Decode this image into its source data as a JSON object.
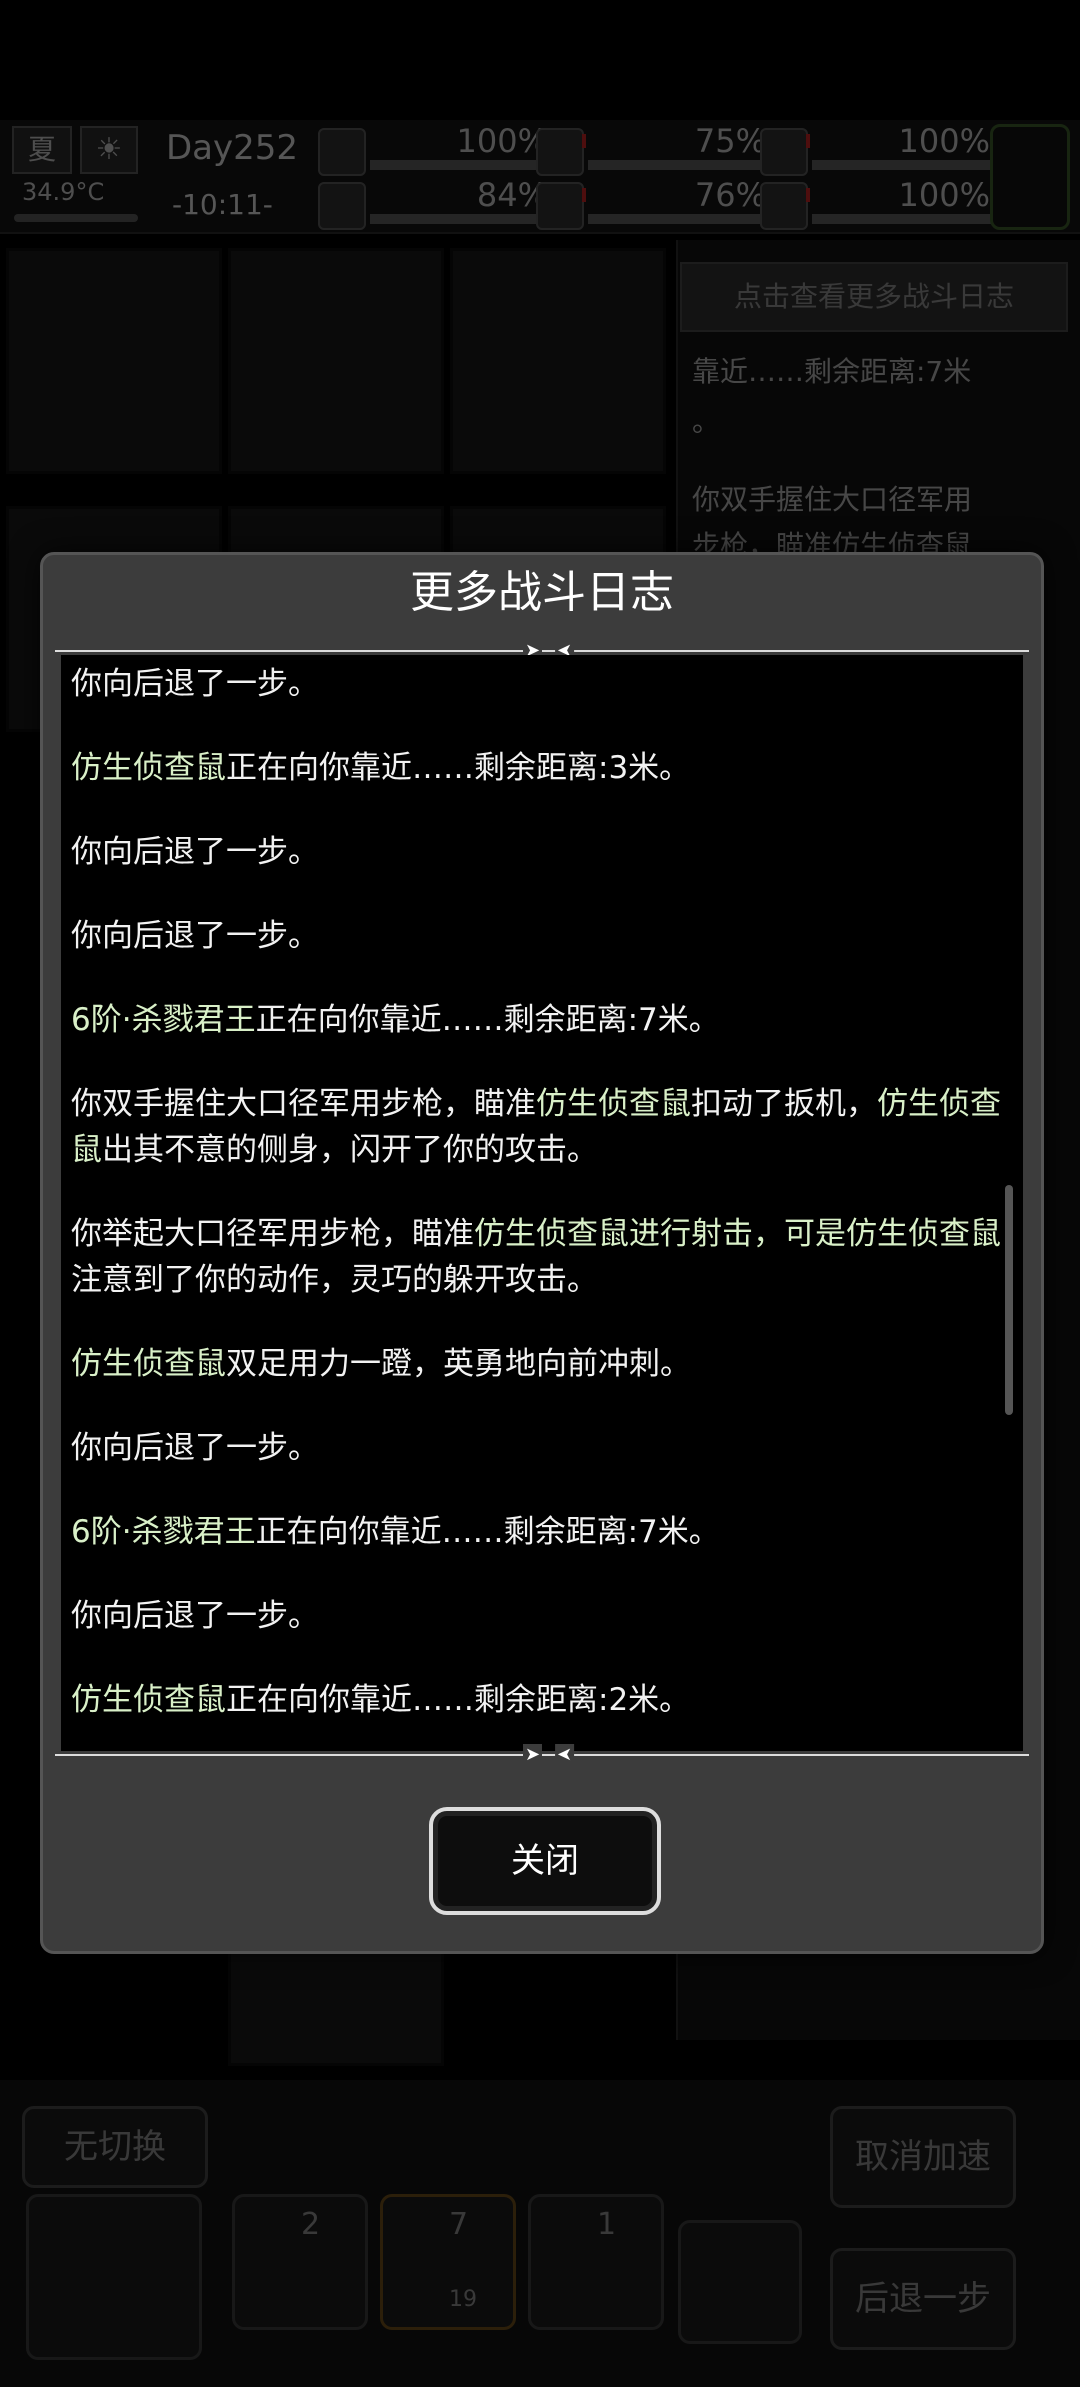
{
  "status": {
    "season": "夏",
    "temperature": "34.9°C",
    "day": "Day252",
    "time": "-10:11-",
    "stats": [
      {
        "icon": "medkit-icon",
        "pct": "100%"
      },
      {
        "icon": "stomach-icon",
        "pct": "75%"
      },
      {
        "icon": "pill-icon",
        "pct": "100%"
      },
      {
        "icon": "leg-icon",
        "pct": "84%"
      },
      {
        "icon": "water-drop-icon",
        "pct": "76%"
      },
      {
        "icon": "heart-icon",
        "pct": "100%"
      }
    ]
  },
  "side_panel": {
    "button": "点击查看更多战斗日志",
    "lines": [
      "靠近……剩余距离:7米",
      "。",
      "你双手握住大口径军用",
      "步枪，瞄准仿生侦查鼠"
    ]
  },
  "dialog": {
    "title": "更多战斗日志",
    "close_label": "关闭",
    "entries": [
      [
        {
          "t": "你向后退了一步。"
        }
      ],
      [
        {
          "t": "仿生侦查鼠",
          "mob": true
        },
        {
          "t": "正在向你靠近……剩余距离:3米。"
        }
      ],
      [
        {
          "t": "你向后退了一步。"
        }
      ],
      [
        {
          "t": "你向后退了一步。"
        }
      ],
      [
        {
          "t": "6阶·杀戮君王",
          "mob": true
        },
        {
          "t": "正在向你靠近……剩余距离:7米。"
        }
      ],
      [
        {
          "t": "你双手握住大口径军用步枪，瞄准"
        },
        {
          "t": "仿生侦查鼠",
          "mob": true
        },
        {
          "t": "扣动了扳机，"
        },
        {
          "t": "仿生侦查鼠",
          "mob": true
        },
        {
          "t": "出其不意的侧身，闪开了你的攻击。"
        }
      ],
      [
        {
          "t": "你举起大口径军用步枪，瞄准"
        },
        {
          "t": "仿生侦查鼠",
          "mob": true
        },
        {
          "t": "进行射击，可是仿生侦查鼠",
          "mob": true
        },
        {
          "t": "注意到了你的动作，灵巧的躲开攻击。"
        }
      ],
      [
        {
          "t": "仿生侦查鼠",
          "mob": true
        },
        {
          "t": "双足用力一蹬，英勇地向前冲刺。"
        }
      ],
      [
        {
          "t": "你向后退了一步。"
        }
      ],
      [
        {
          "t": "6阶·杀戮君王",
          "mob": true
        },
        {
          "t": "正在向你靠近……剩余距离:7米。"
        }
      ],
      [
        {
          "t": "你向后退了一步。"
        }
      ],
      [
        {
          "t": "仿生侦查鼠",
          "mob": true
        },
        {
          "t": "正在向你靠近……剩余距离:2米。"
        }
      ]
    ]
  },
  "bottom": {
    "no_switch": "无切换",
    "cancel_speed": "取消加速",
    "step_back": "后退一步",
    "weapon_slots": [
      {
        "icon": "knife-icon",
        "count": "2"
      },
      {
        "icon": "rifle-icon",
        "count": "7",
        "ammo": "19"
      },
      {
        "icon": "claw-icon",
        "count": "1"
      }
    ]
  }
}
